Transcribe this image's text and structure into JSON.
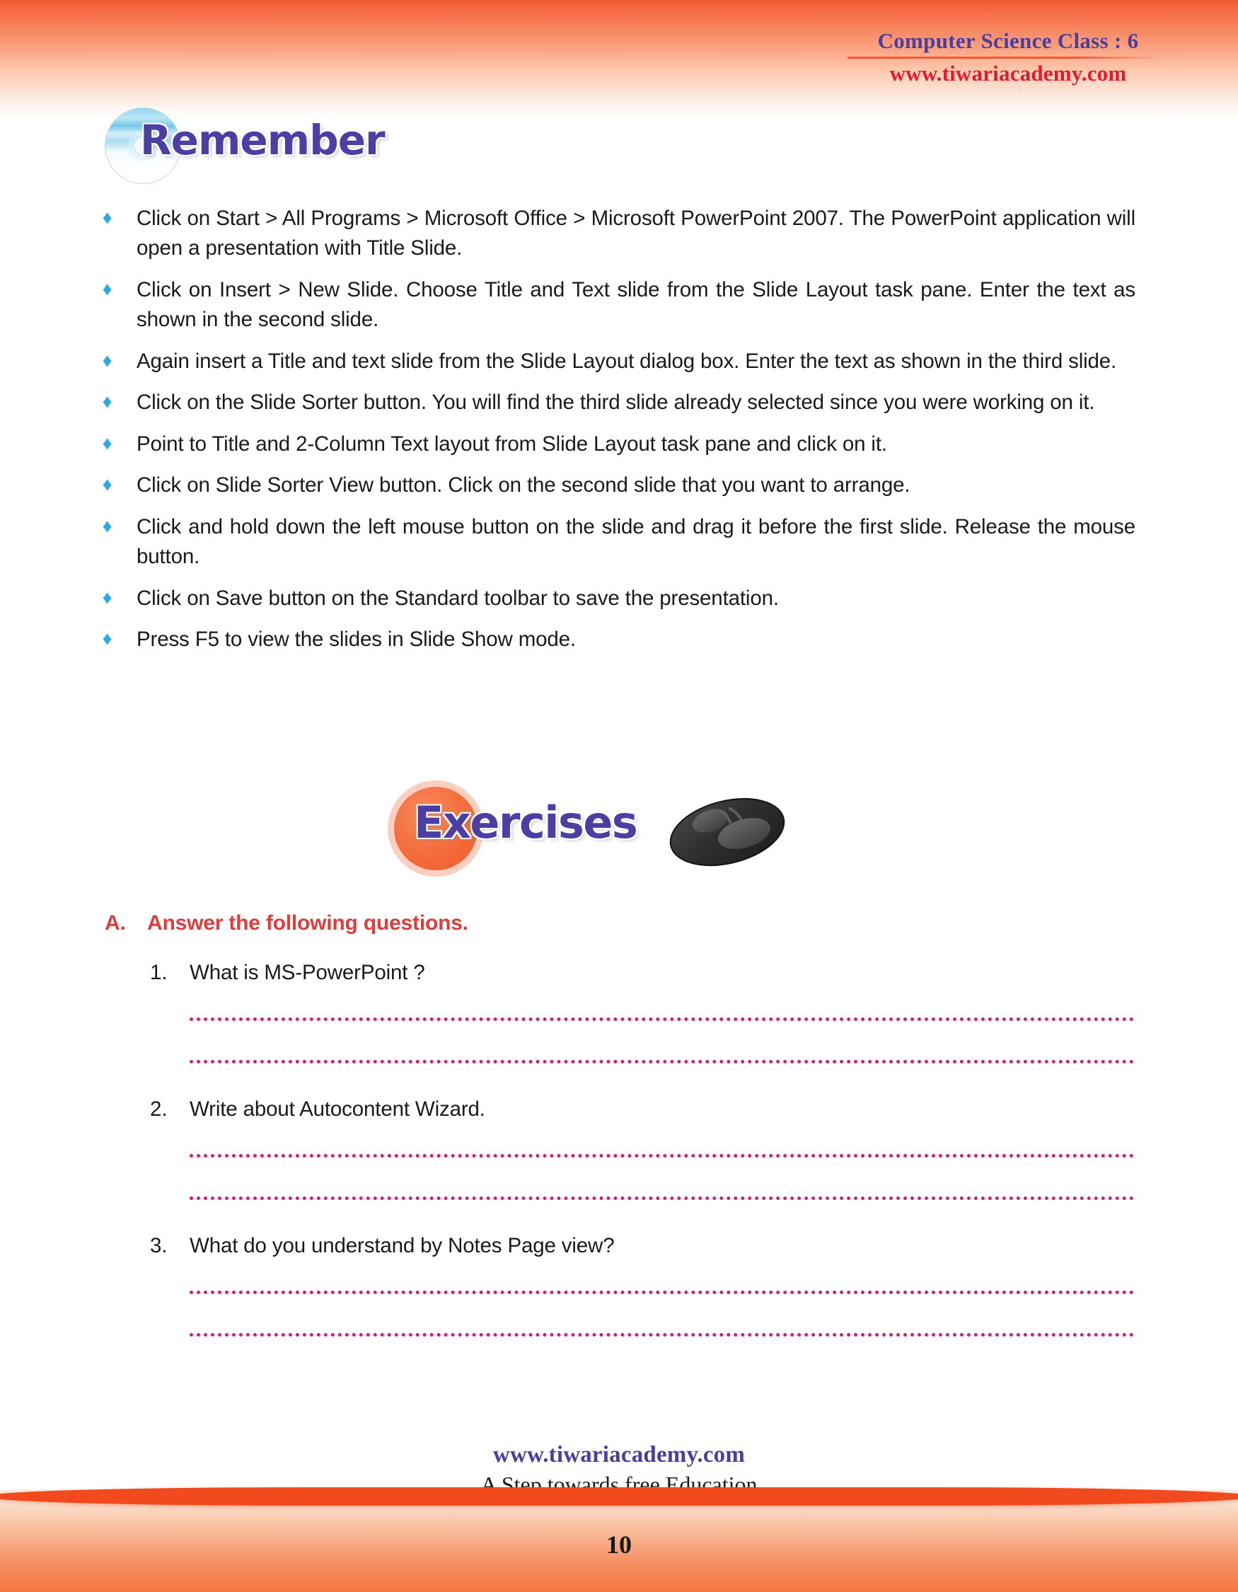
{
  "header": {
    "title": "Computer Science Class : 6",
    "url": "www.tiwariacademy.com",
    "title_color": "#4a3f9e",
    "url_color": "#e8192c"
  },
  "remember": {
    "heading": "Remember",
    "heading_color": "#4b3fa3",
    "bullet_color": "#29abe2",
    "bullet_glyph": "♦",
    "items": [
      "Click on Start > All Programs > Microsoft Office > Microsoft PowerPoint 2007. The PowerPoint application will open a presentation with Title Slide.",
      "Click on Insert > New Slide. Choose Title and Text slide from the Slide Layout task pane. Enter the text as shown in the second slide.",
      "Again insert a Title and text slide from the Slide Layout dialog box. Enter the text as shown in the third slide.",
      "Click on the Slide Sorter button. You will find the third slide already selected since you were working on it.",
      "Point to Title and 2-Column Text layout from Slide Layout task pane and click on it.",
      "Click on Slide Sorter View button. Click on the second slide that you want to arrange.",
      "Click and hold down the left mouse button on the slide and drag it before the first slide. Release the mouse button.",
      "Click on Save button on the Standard toolbar to save the presentation.",
      "Press  F5 to view the slides in Slide Show mode."
    ]
  },
  "exercises": {
    "heading": "Exercises",
    "heading_color": "#4b3fa3",
    "circle_color": "#f4713f",
    "mouse_icon": "computer-mouse-icon"
  },
  "section_a": {
    "letter": "A.",
    "title": "Answer the following questions.",
    "color": "#e23b3b",
    "questions": [
      {
        "num": "1.",
        "text": "What is MS-PowerPoint ?"
      },
      {
        "num": "2.",
        "text": "Write about Autocontent Wizard."
      },
      {
        "num": "3.",
        "text": "What do you understand by Notes Page view?"
      }
    ],
    "answer_line_color": "#d51f6b",
    "answer_lines_per_question": 2
  },
  "footer": {
    "url": "www.tiwariacademy.com",
    "tagline": "A Step towards free Education",
    "page_number": "10",
    "url_color": "#4a3f9e",
    "band_color": "#f14a1f"
  }
}
